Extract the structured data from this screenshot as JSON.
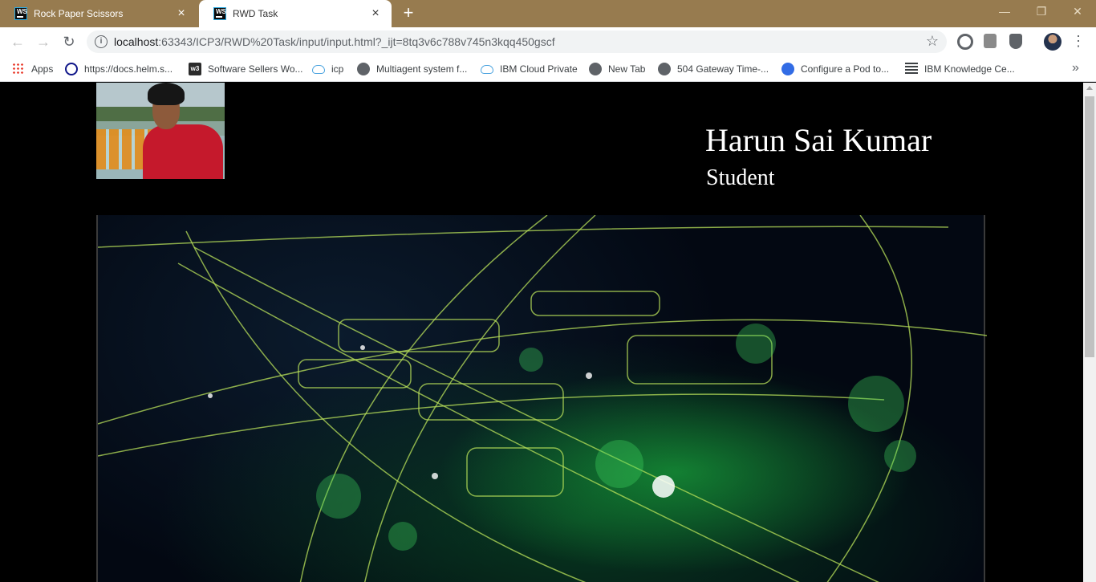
{
  "browser": {
    "tabs": [
      {
        "title": "Rock Paper Scissors",
        "icon": "webstorm-icon",
        "active": false
      },
      {
        "title": "RWD Task",
        "icon": "webstorm-icon",
        "active": true
      }
    ],
    "new_tab_glyph": "+",
    "window_controls": {
      "minimize": "—",
      "maximize": "❐",
      "close": "✕"
    },
    "url": {
      "host": "localhost",
      "rest": ":63343/ICP3/RWD%20Task/input/input.html?_ijt=8tq3v6c788v745n3kqq450gscf"
    },
    "nav": {
      "back": "←",
      "forward": "→",
      "reload": "↻",
      "star": "☆",
      "menu": "⋮",
      "info": "i"
    },
    "bookmarks": [
      {
        "label": "Apps",
        "icon": "apps-grid-icon"
      },
      {
        "label": "https://docs.helm.s...",
        "icon": "helm-icon"
      },
      {
        "label": "Software Sellers Wo...",
        "icon": "w3-icon"
      },
      {
        "label": "icp",
        "icon": "cloud-icon"
      },
      {
        "label": "Multiagent system f...",
        "icon": "globe-icon"
      },
      {
        "label": "IBM Cloud Private",
        "icon": "cloud-icon"
      },
      {
        "label": "New Tab",
        "icon": "globe-icon"
      },
      {
        "label": "504 Gateway Time-...",
        "icon": "globe-icon"
      },
      {
        "label": "Configure a Pod to...",
        "icon": "kubernetes-icon"
      },
      {
        "label": "IBM Knowledge Ce...",
        "icon": "ibm-icon"
      }
    ],
    "bookmarks_overflow": "»"
  },
  "page": {
    "name": "Harun Sai Kumar",
    "role": "Student"
  },
  "colors": {
    "titlebar": "#977b4f",
    "page_bg": "#000000",
    "accent_green": "#b8e05a"
  }
}
